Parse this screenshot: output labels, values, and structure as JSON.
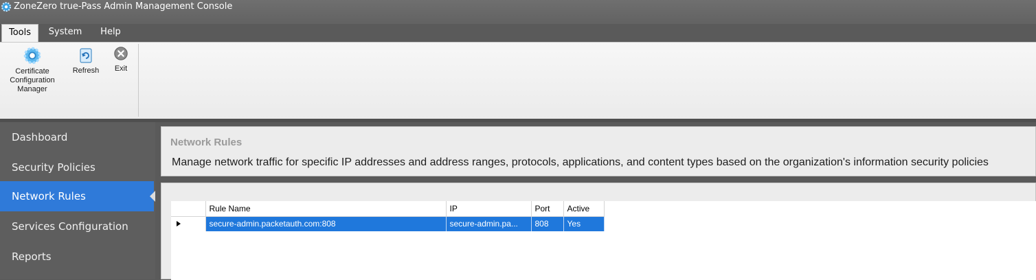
{
  "window": {
    "title": "ZoneZero true-Pass Admin Management Console",
    "icon": "gear-icon"
  },
  "menubar": {
    "items": [
      "Tools",
      "System",
      "Help"
    ],
    "active": "Tools"
  },
  "ribbon": {
    "buttons": [
      {
        "label": "Certificate Configuration Manager",
        "icon": "certificate-gear-icon"
      },
      {
        "label": "Refresh",
        "icon": "refresh-icon"
      },
      {
        "label": "Exit",
        "icon": "exit-icon"
      }
    ]
  },
  "sidebar": {
    "items": [
      {
        "label": "Dashboard"
      },
      {
        "label": "Security Policies"
      },
      {
        "label": "Network Rules",
        "selected": true
      },
      {
        "label": "Services Configuration"
      },
      {
        "label": "Reports"
      }
    ]
  },
  "page": {
    "title": "Network Rules",
    "description": "Manage network traffic for specific IP addresses and address ranges, protocols, applications, and content types based on the organization's information security policies"
  },
  "grid": {
    "columns": [
      "Rule Name",
      "IP",
      "Port",
      "Active"
    ],
    "rows": [
      {
        "rule_name": "secure-admin.packetauth.com:808",
        "ip": "secure-admin.pa...",
        "port": "808",
        "active": "Yes",
        "selected": true
      }
    ]
  },
  "colors": {
    "accent": "#2f7ad9",
    "selection": "#1f78dc",
    "sidebar": "#5e5e5e"
  }
}
